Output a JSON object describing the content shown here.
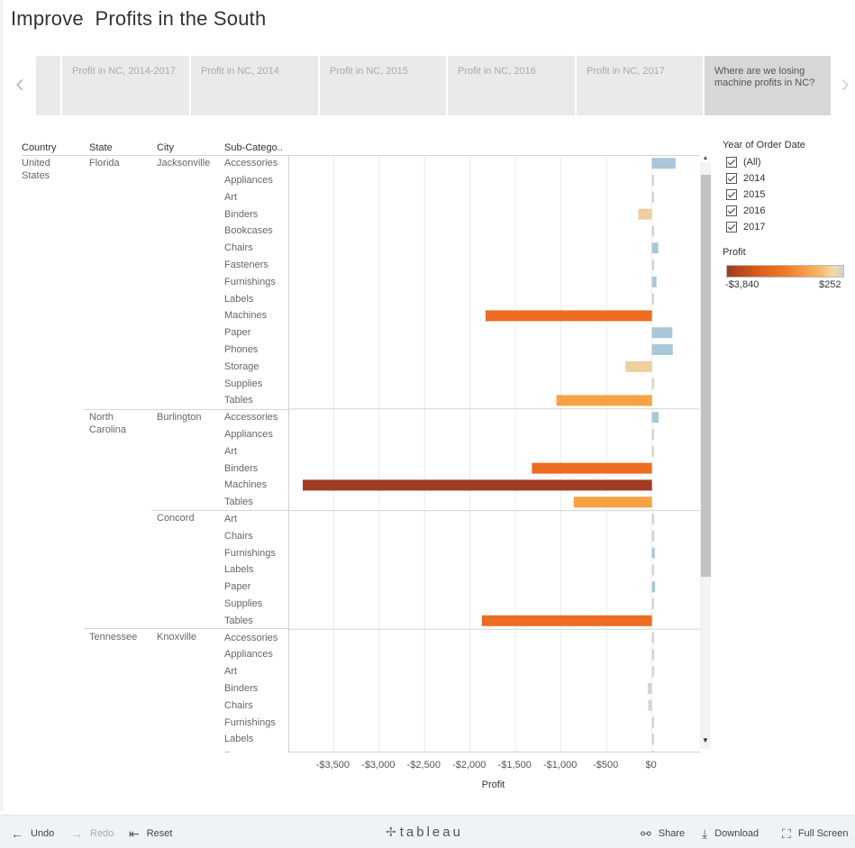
{
  "story": {
    "title": "Improve  Profits in the South",
    "nav_prev": "‹",
    "nav_next": "›",
    "points": [
      {
        "label": ""
      },
      {
        "label": "Profit in NC, 2014-2017"
      },
      {
        "label": "Profit in NC, 2014"
      },
      {
        "label": "Profit in NC, 2015"
      },
      {
        "label": "Profit in NC, 2016"
      },
      {
        "label": "Profit in NC, 2017"
      },
      {
        "label": "Where are we losing machine profits in NC?"
      }
    ],
    "active_index": 6
  },
  "headers": {
    "country": "Country",
    "state": "State",
    "city": "City",
    "subcategory": "Sub-Catego.."
  },
  "groups": [
    {
      "country": "United States",
      "state": "Florida",
      "city": "Jacksonville"
    },
    {
      "state": "North Carolina",
      "city": "Burlington"
    },
    {
      "city": "Concord"
    },
    {
      "state": "Tennessee",
      "city": "Knoxville"
    }
  ],
  "chart_data": {
    "type": "bar",
    "orientation": "horizontal",
    "x_label": "Profit",
    "xlim": [
      -3900,
      450
    ],
    "x_ticks": [
      "-$3,500",
      "-$3,000",
      "-$2,500",
      "-$2,000",
      "-$1,500",
      "-$1,000",
      "-$500",
      "$0"
    ],
    "x_tick_values": [
      -3500,
      -3000,
      -2500,
      -2000,
      -1500,
      -1000,
      -500,
      0
    ],
    "rows": [
      {
        "group": 0,
        "sub": "Accessories",
        "value": 260
      },
      {
        "group": 0,
        "sub": "Appliances",
        "value": 0
      },
      {
        "group": 0,
        "sub": "Art",
        "value": 5
      },
      {
        "group": 0,
        "sub": "Binders",
        "value": -150
      },
      {
        "group": 0,
        "sub": "Bookcases",
        "value": 0
      },
      {
        "group": 0,
        "sub": "Chairs",
        "value": 70
      },
      {
        "group": 0,
        "sub": "Fasteners",
        "value": 0
      },
      {
        "group": 0,
        "sub": "Furnishings",
        "value": 50
      },
      {
        "group": 0,
        "sub": "Labels",
        "value": 0
      },
      {
        "group": 0,
        "sub": "Machines",
        "value": -1830
      },
      {
        "group": 0,
        "sub": "Paper",
        "value": 225
      },
      {
        "group": 0,
        "sub": "Phones",
        "value": 230
      },
      {
        "group": 0,
        "sub": "Storage",
        "value": -290
      },
      {
        "group": 0,
        "sub": "Supplies",
        "value": 0
      },
      {
        "group": 0,
        "sub": "Tables",
        "value": -1050
      },
      {
        "group": 1,
        "sub": "Accessories",
        "value": 75
      },
      {
        "group": 1,
        "sub": "Appliances",
        "value": 5
      },
      {
        "group": 1,
        "sub": "Art",
        "value": 3
      },
      {
        "group": 1,
        "sub": "Binders",
        "value": -1320
      },
      {
        "group": 1,
        "sub": "Machines",
        "value": -3840
      },
      {
        "group": 1,
        "sub": "Tables",
        "value": -860
      },
      {
        "group": 2,
        "sub": "Art",
        "value": 5
      },
      {
        "group": 2,
        "sub": "Chairs",
        "value": 0
      },
      {
        "group": 2,
        "sub": "Furnishings",
        "value": 30
      },
      {
        "group": 2,
        "sub": "Labels",
        "value": 0
      },
      {
        "group": 2,
        "sub": "Paper",
        "value": 35
      },
      {
        "group": 2,
        "sub": "Supplies",
        "value": 0
      },
      {
        "group": 2,
        "sub": "Tables",
        "value": -1870
      },
      {
        "group": 3,
        "sub": "Accessories",
        "value": 0
      },
      {
        "group": 3,
        "sub": "Appliances",
        "value": 5
      },
      {
        "group": 3,
        "sub": "Art",
        "value": 10
      },
      {
        "group": 3,
        "sub": "Binders",
        "value": -45
      },
      {
        "group": 3,
        "sub": "Chairs",
        "value": -40
      },
      {
        "group": 3,
        "sub": "Furnishings",
        "value": 25
      },
      {
        "group": 3,
        "sub": "Labels",
        "value": 15
      },
      {
        "group": 3,
        "sub": "Paper",
        "value": 0
      }
    ],
    "grid": "vertical"
  },
  "filter": {
    "title": "Year of Order Date",
    "options": [
      {
        "label": "(All)",
        "checked": true
      },
      {
        "label": "2014",
        "checked": true
      },
      {
        "label": "2015",
        "checked": true
      },
      {
        "label": "2016",
        "checked": true
      },
      {
        "label": "2017",
        "checked": true
      }
    ]
  },
  "legend": {
    "title": "Profit",
    "min_label": "-$3,840",
    "max_label": "$252",
    "min_value": -3840,
    "max_value": 252
  },
  "colors": {
    "positive": "#a9c7d6",
    "near_zero": "#d5d5cf",
    "small_negative": "#efcfa0",
    "mid_negative": "#f6a244",
    "large_negative": "#ec6c24",
    "max_negative": "#a13b21",
    "grid": "#ececec",
    "separator": "#d6d6d6"
  },
  "toolbar": {
    "undo": "Undo",
    "redo": "Redo",
    "reset": "Reset",
    "brand": "tableau",
    "share": "Share",
    "download": "Download",
    "fullscreen": "Full Screen"
  }
}
